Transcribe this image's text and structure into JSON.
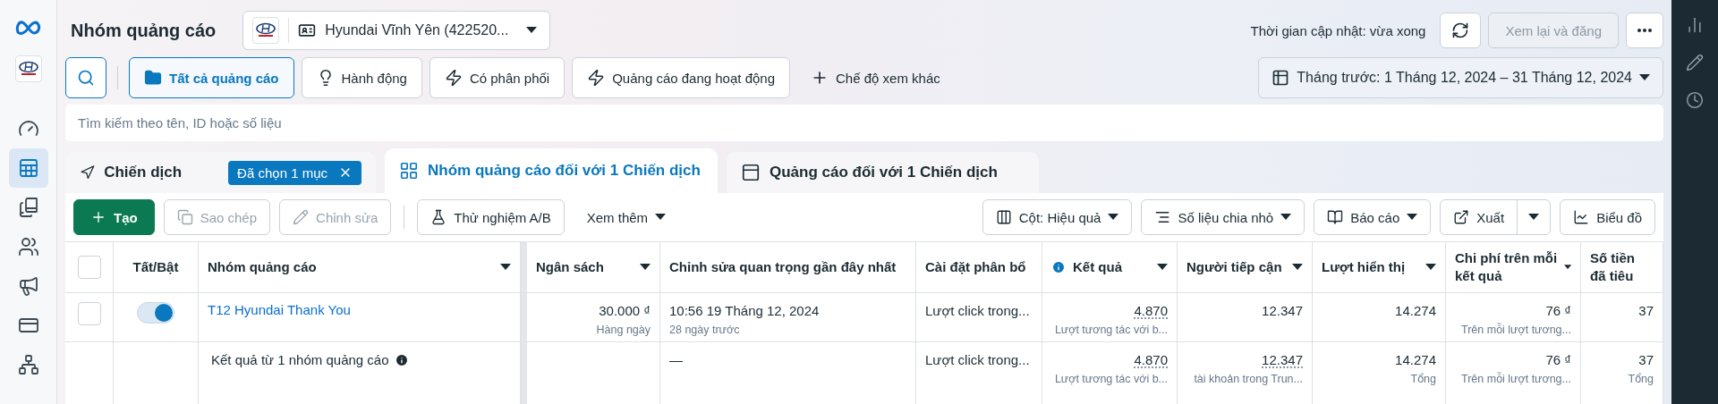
{
  "nav": {
    "items": [
      {
        "kind": "gauge",
        "selected": false
      },
      {
        "kind": "table",
        "selected": true
      },
      {
        "kind": "pages",
        "selected": false
      },
      {
        "kind": "people",
        "selected": false
      },
      {
        "kind": "megaphone",
        "selected": false
      },
      {
        "kind": "card",
        "selected": false
      },
      {
        "kind": "network",
        "selected": false
      }
    ]
  },
  "header": {
    "title": "Nhóm quảng cáo",
    "account": {
      "name": "Hyundai Vĩnh Yên (422520..."
    },
    "update_status": "Thời gian cập nhật: vừa xong",
    "publish_button": {
      "label": "Xem lại và đăng",
      "disabled": true
    }
  },
  "filters": {
    "chips": [
      {
        "label": "Tất cả quảng cáo",
        "selected": true
      },
      {
        "label": "Hành động",
        "selected": false
      },
      {
        "label": "Có phân phối",
        "selected": false
      },
      {
        "label": "Quảng cáo đang hoạt động",
        "selected": false
      }
    ],
    "more_views": "Chế độ xem khác",
    "date_range": "Tháng trước: 1 Tháng 12, 2024 – 31 Tháng 12, 2024"
  },
  "search": {
    "placeholder": "Tìm kiếm theo tên, ID hoặc số liệu"
  },
  "tabs": [
    {
      "label": "Chiến dịch",
      "selected": false,
      "badge": "Đã chọn 1 mục"
    },
    {
      "label": "Nhóm quảng cáo đối với 1 Chiến dịch",
      "selected": true
    },
    {
      "label": "Quảng cáo đối với 1 Chiến dịch",
      "selected": false
    }
  ],
  "toolbar": {
    "left": [
      {
        "label": "Tạo",
        "kind": "primary",
        "disabled": false
      },
      {
        "label": "Sao chép",
        "kind": "default",
        "disabled": true
      },
      {
        "label": "Chỉnh sửa",
        "kind": "default",
        "disabled": true
      },
      {
        "label": "Thử nghiệm A/B",
        "kind": "default",
        "disabled": false
      },
      {
        "label": "Xem thêm",
        "kind": "plain",
        "disabled": false
      }
    ],
    "right": [
      {
        "label": "Cột: Hiệu quả",
        "kind": "dropdown"
      },
      {
        "label": "Số liệu chia nhỏ",
        "kind": "dropdown"
      },
      {
        "label": "Báo cáo",
        "kind": "dropdown"
      },
      {
        "label": "Xuất",
        "kind": "split"
      },
      {
        "label": "Biểu đồ",
        "kind": "button"
      }
    ]
  },
  "table": {
    "select_all": {
      "checked": false
    },
    "columns": [
      {
        "label": "Tất/Bật",
        "sortable": false
      },
      {
        "label": "Nhóm quảng cáo",
        "sortable": true
      },
      {
        "label": "Ngân sách",
        "sortable": true
      },
      {
        "label": "Chỉnh sửa quan trọng gần đây nhất",
        "sortable": false
      },
      {
        "label": "Cài đặt phân bổ",
        "sortable": false
      },
      {
        "label": "Kết quả",
        "sortable": true,
        "info": true
      },
      {
        "label": "Người tiếp cận",
        "sortable": true
      },
      {
        "label": "Lượt hiển thị",
        "sortable": true
      },
      {
        "label": "Chi phí trên mỗi kết quả",
        "sortable": true
      },
      {
        "label": "Số tiền đã tiêu",
        "sortable": false
      }
    ],
    "rows": [
      {
        "kind": "adset",
        "checked": false,
        "cells": [
          {
            "on": true
          },
          {
            "value": "T12 Hyundai Thank You"
          },
          {
            "value": "30.000 ₫",
            "sub": "Hàng ngày"
          },
          {
            "value": "10:56 19 Tháng 12, 2024",
            "sub": "28 ngày trước"
          },
          {
            "value": "Lượt click trong..."
          },
          {
            "value": "4.870",
            "sub": "Lượt tương tác với b...",
            "dotted": true
          },
          {
            "value": "12.347"
          },
          {
            "value": "14.274"
          },
          {
            "value": "76 ₫",
            "sub": "Trên mỗi lượt tương..."
          },
          {
            "value": "37"
          }
        ]
      },
      {
        "kind": "summary",
        "cells": [
          {},
          {
            "value": "Kết quả từ 1 nhóm quảng cáo"
          },
          {},
          {
            "value": "—"
          },
          {
            "value": "Lượt click trong..."
          },
          {
            "value": "4.870",
            "sub": "Lượt tương tác với b...",
            "dotted": true
          },
          {
            "value": "12.347",
            "sub": "tài khoản trong Trun...",
            "dotted": true
          },
          {
            "value": "14.274",
            "sub": "Tổng"
          },
          {
            "value": "76 ₫",
            "sub": "Trên mỗi lượt tương..."
          },
          {
            "value": "37",
            "sub": "Tổng"
          }
        ]
      }
    ]
  },
  "right_rail": {
    "items": [
      {
        "kind": "chart"
      },
      {
        "kind": "pencil"
      },
      {
        "kind": "clock"
      }
    ]
  }
}
